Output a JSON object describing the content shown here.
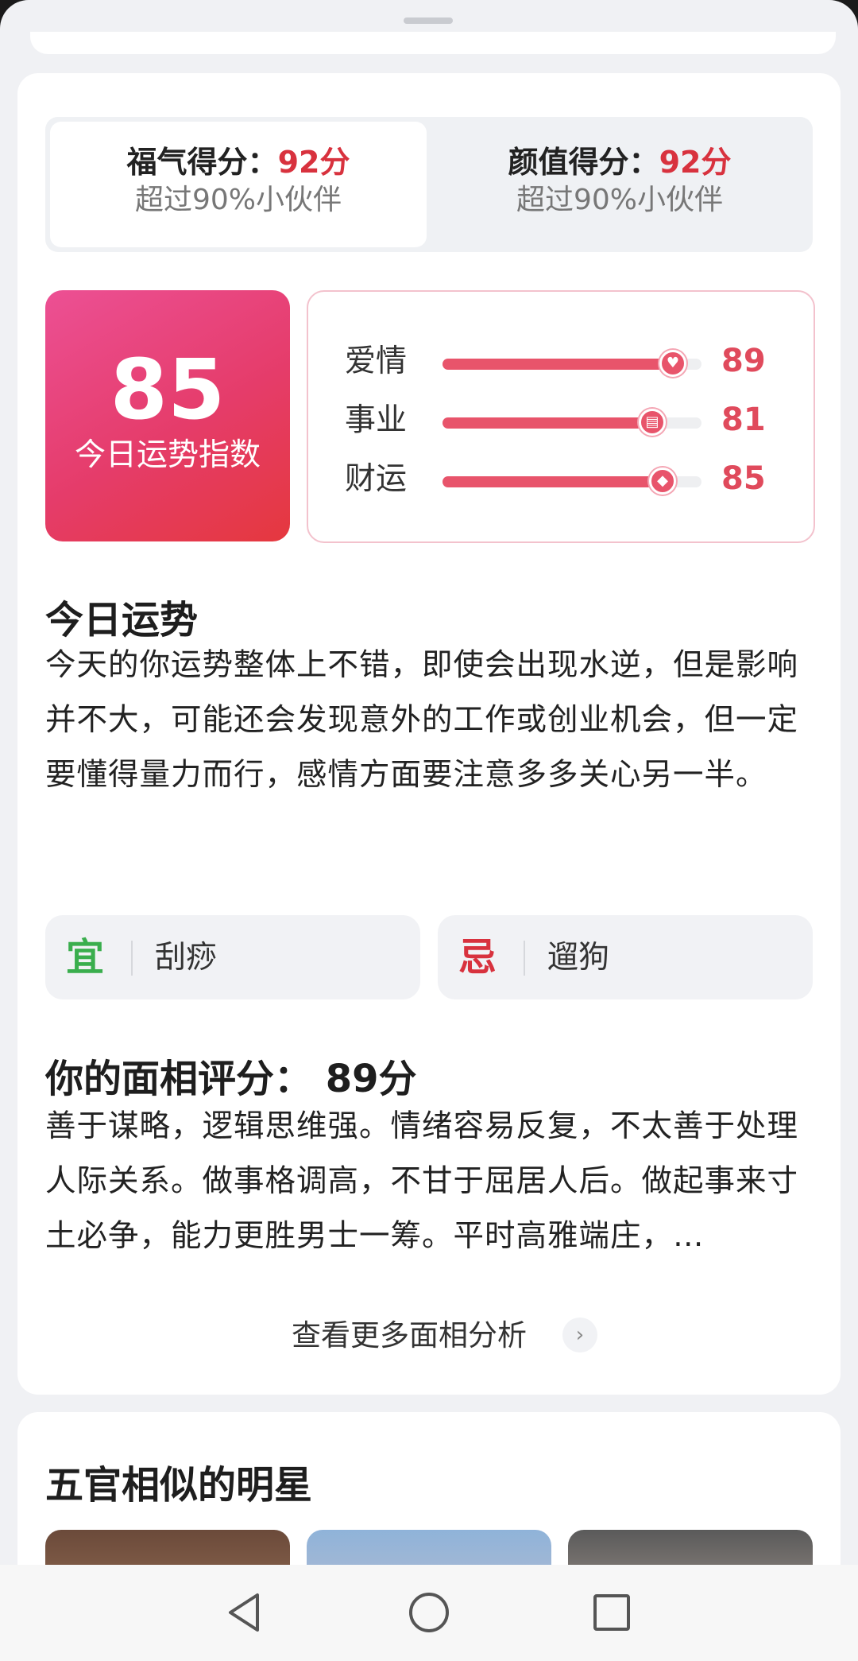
{
  "score_tabs": [
    {
      "label": "福气得分：",
      "score": "92分",
      "sub": "超过90%小伙伴"
    },
    {
      "label": "颜值得分：",
      "score": "92分",
      "sub": "超过90%小伙伴"
    }
  ],
  "fortune_index": {
    "value": "85",
    "label": "今日运势指数"
  },
  "fortune_bars": [
    {
      "label": "爱情",
      "value": "89",
      "fraction": 0.89
    },
    {
      "label": "事业",
      "value": "81",
      "fraction": 0.81
    },
    {
      "label": "财运",
      "value": "85",
      "fraction": 0.85
    }
  ],
  "today_fortune": {
    "title": "今日运势",
    "text": "今天的你运势整体上不错，即使会出现水逆，但是影响并不大，可能还会发现意外的工作或创业机会，但一定要懂得量力而行，感情方面要注意多多关心另一半。"
  },
  "yi": {
    "char": "宜",
    "text": "刮痧",
    "color": "#3aae4d"
  },
  "ji": {
    "char": "忌",
    "text": "遛狗",
    "color": "#d8323e"
  },
  "face_score": {
    "title": "你的面相评分：  89分",
    "text": "善于谋略，逻辑思维强。情绪容易反复，不太善于处理人际关系。做事格调高，不甘于屈居人后。做起事来寸土必争，能力更胜男士一筹。平时高雅端庄，…"
  },
  "more_link": {
    "label": "查看更多面相分析",
    "arrow": "›"
  },
  "similar_stars": {
    "title": "五官相似的明星"
  },
  "colors": {
    "accent": "#e8546b",
    "red": "#d8323e",
    "green": "#3aae4d"
  }
}
